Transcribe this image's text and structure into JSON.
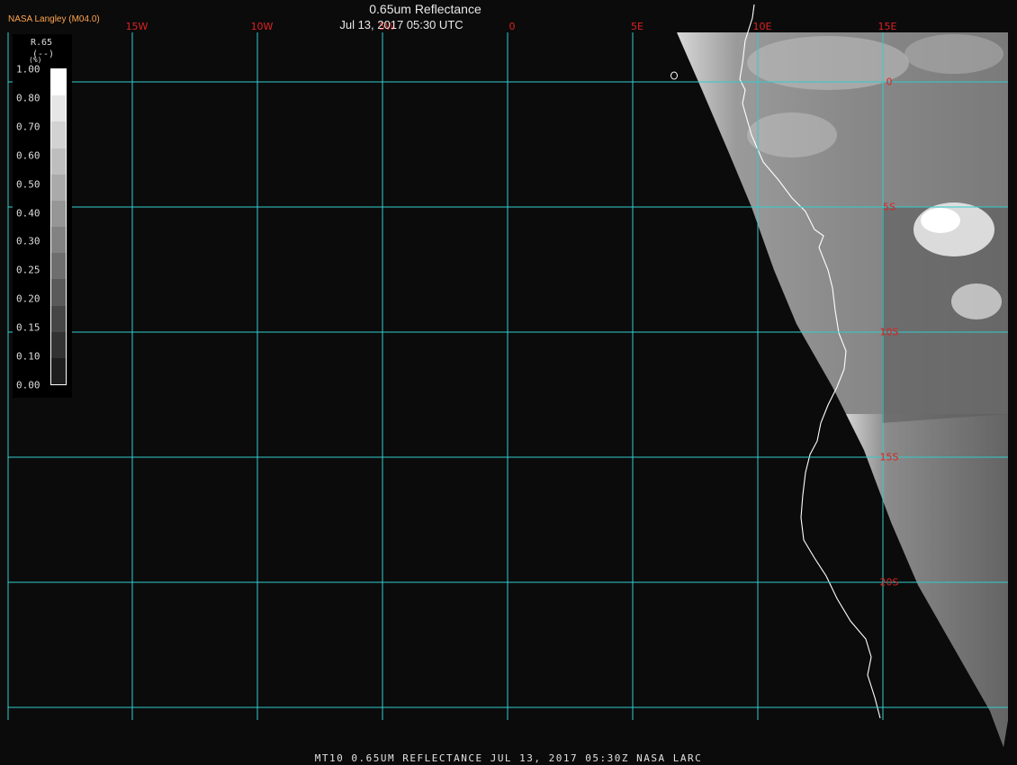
{
  "header": {
    "source": "NASA Langley (M04.0)",
    "title": "0.65um Reflectance",
    "timestamp": "Jul 13, 2017 05:30 UTC"
  },
  "footer": {
    "text": "MT10  0.65UM REFLECTANCE   JUL 13, 2017 05:30Z   NASA LARC"
  },
  "colorbar": {
    "variable": "R.65",
    "unit": "(--)",
    "unit_paren": "(%)",
    "ticks": [
      "1.00",
      "0.80",
      "0.70",
      "0.60",
      "0.50",
      "0.40",
      "0.30",
      "0.25",
      "0.20",
      "0.15",
      "0.10",
      "0.00"
    ],
    "shades": [
      "#ffffff",
      "#e6e6e6",
      "#d2d2d2",
      "#bebebe",
      "#aaaaaa",
      "#969696",
      "#828282",
      "#6e6e6e",
      "#5a5a5a",
      "#464646",
      "#323232",
      "#1e1e1e"
    ]
  },
  "map": {
    "longitude_labels": [
      {
        "text": "15W",
        "lon": -15
      },
      {
        "text": "10W",
        "lon": -10
      },
      {
        "text": "5W",
        "lon": -5
      },
      {
        "text": "0",
        "lon": 0
      },
      {
        "text": "5E",
        "lon": 5
      },
      {
        "text": "10E",
        "lon": 10
      },
      {
        "text": "15E",
        "lon": 15
      }
    ],
    "latitude_labels": [
      {
        "text": "0",
        "lat": 0
      },
      {
        "text": "5S",
        "lat": -5
      },
      {
        "text": "10S",
        "lat": -10
      },
      {
        "text": "15S",
        "lat": -15
      },
      {
        "text": "20S",
        "lat": -20
      }
    ],
    "grid_color": "#33cccc",
    "label_color": "#dd2222",
    "coastline_color": "#ffffff"
  }
}
